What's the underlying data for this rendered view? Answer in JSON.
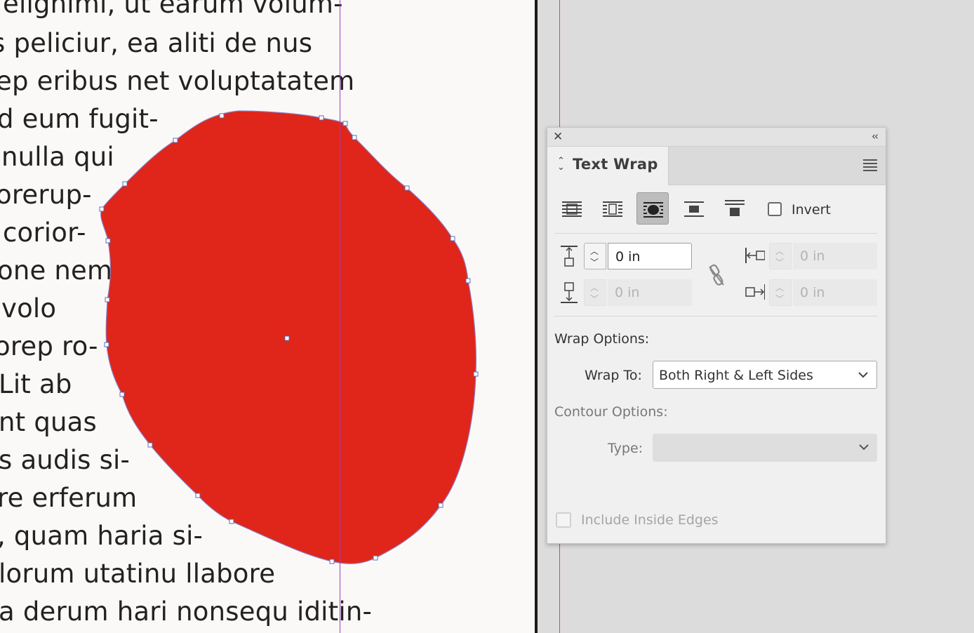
{
  "document": {
    "text_lines": [
      "elignimi, ut earum volum-",
      "s peliciur, ea aliti de nus",
      "ep eribus net voluptatatem",
      "d eum fugit-",
      "nulla qui",
      "orerup-",
      "corior-",
      "one nem",
      "volo",
      "orep ro-",
      "Lit ab",
      "nt quas",
      "s audis si-",
      "re erferum",
      ", quam haria si-",
      "lorum utatinu llabore",
      "a derum hari nonsequ iditin-"
    ],
    "shape_color": "#e0251a",
    "guide_color": "#9b3fbf",
    "margin_guide_color": "#d2476e"
  },
  "panel": {
    "close_icon": "close-icon",
    "collapse_icon": "double-chevron-left-icon",
    "tab_label": "Text Wrap",
    "menu_icon": "panel-menu-icon",
    "wrap_modes": [
      {
        "name": "no-text-wrap",
        "selected": false
      },
      {
        "name": "wrap-around-bounding-box",
        "selected": false
      },
      {
        "name": "wrap-around-object-shape",
        "selected": true
      },
      {
        "name": "jump-object",
        "selected": false
      },
      {
        "name": "jump-to-next-column",
        "selected": false
      }
    ],
    "invert_label": "Invert",
    "invert_checked": false,
    "offsets": {
      "top": "0 in",
      "bottom": "0 in",
      "left": "0 in",
      "right": "0 in"
    },
    "wrap_options_label": "Wrap Options:",
    "wrap_to_label": "Wrap To:",
    "wrap_to_value": "Both Right & Left Sides",
    "contour_options_label": "Contour Options:",
    "type_label": "Type:",
    "type_value": "",
    "include_inside_edges_label": "Include Inside Edges",
    "include_inside_edges_checked": false
  }
}
